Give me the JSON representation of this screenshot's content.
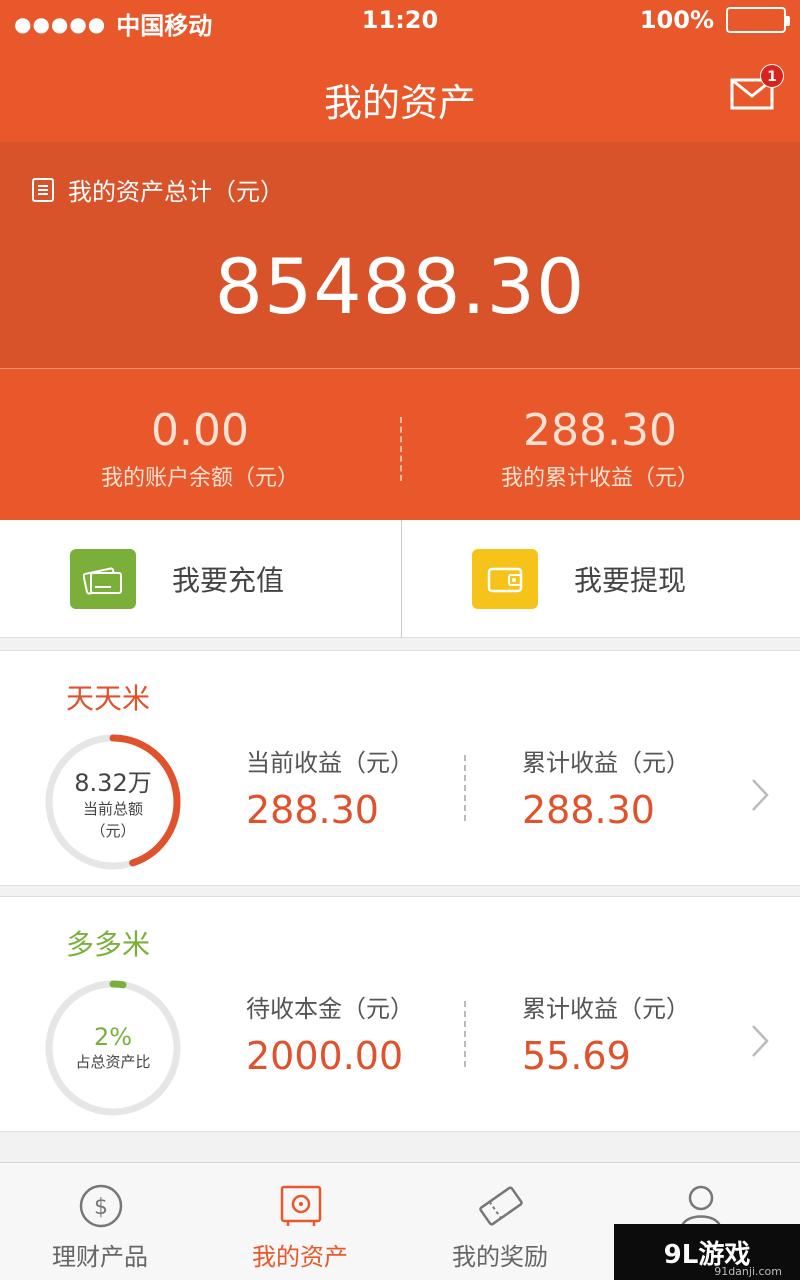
{
  "status_bar": {
    "signal": "●●●●●",
    "carrier": "中国移动",
    "time": "11:20",
    "battery": "100%"
  },
  "nav": {
    "title": "我的资产",
    "mail_icon": "mail-icon",
    "mail_badge": "1"
  },
  "total": {
    "label": "我的资产总计（元）",
    "value": "85488.30"
  },
  "split": {
    "balance_value": "0.00",
    "balance_label": "我的账户余额（元）",
    "income_value": "288.30",
    "income_label": "我的累计收益（元）"
  },
  "actions": {
    "recharge": "我要充值",
    "withdraw": "我要提现"
  },
  "products": [
    {
      "title": "天天米",
      "ring_value": "8.32万",
      "ring_label": "当前总额",
      "ring_unit": "（元）",
      "ring_progress": 0.45,
      "left_label": "当前收益（元）",
      "left_value": "288.30",
      "right_label": "累计收益（元）",
      "right_value": "288.30",
      "color": "#e0522b"
    },
    {
      "title": "多多米",
      "ring_value": "2%",
      "ring_label": "占总资产比",
      "ring_progress": 0.02,
      "left_label": "待收本金（元）",
      "left_value": "2000.00",
      "right_label": "累计收益（元）",
      "right_value": "55.69",
      "color": "#7ab03a"
    }
  ],
  "tabs": [
    {
      "label": "理财产品",
      "icon": "dollar-icon"
    },
    {
      "label": "我的资产",
      "icon": "safe-icon",
      "active": true
    },
    {
      "label": "我的奖励",
      "icon": "ticket-icon"
    },
    {
      "label": "",
      "icon": "user-icon"
    }
  ],
  "watermark": {
    "text": "9L游戏",
    "sub": "91danji.com"
  },
  "colors": {
    "primary": "#e8582a",
    "header_dark": "#d9532a",
    "green": "#7ab03a",
    "yellow": "#f6c31b"
  }
}
